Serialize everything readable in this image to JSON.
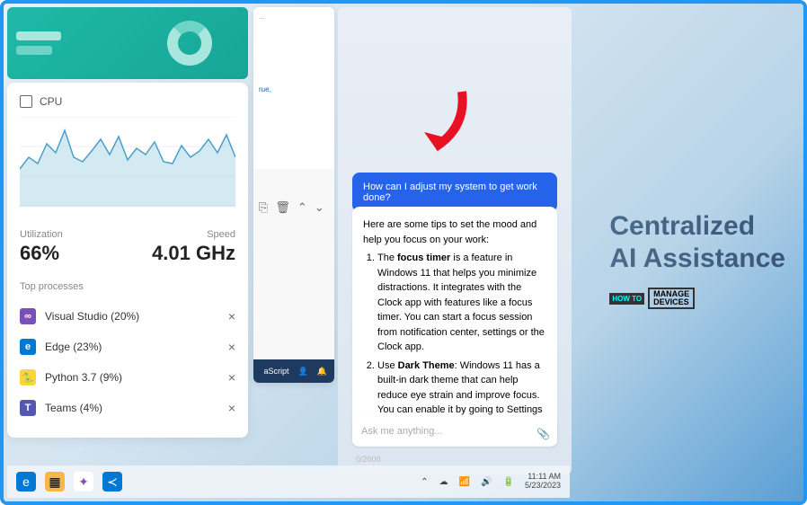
{
  "cpu": {
    "title": "CPU",
    "utilization_label": "Utilization",
    "utilization_value": "66%",
    "speed_label": "Speed",
    "speed_value": "4.01 GHz",
    "top_processes_label": "Top processes",
    "processes": [
      {
        "name": "Visual Studio (20%)",
        "color": "#7b4fb8"
      },
      {
        "name": "Edge (23%)",
        "color": "#0078d4"
      },
      {
        "name": "Python 3.7 (9%)",
        "color": "#ffd43b"
      },
      {
        "name": "Teams (4%)",
        "color": "#5558af"
      }
    ]
  },
  "code_window": {
    "snippet": "rue,",
    "language": "aScript",
    "toolbar_icons": [
      "copy-icon",
      "delete-icon",
      "chevron-up-icon",
      "chevron-down-icon"
    ]
  },
  "ai": {
    "user_message": "How can I adjust my system to get work done?",
    "reply_intro": "Here are some tips to set the mood and help you focus on your work:",
    "tip1_bold": "focus timer",
    "tip1_pre": "The ",
    "tip1_post": " is a feature in Windows 11 that helps you minimize distractions. It integrates with the Clock app with features like a focus timer. You can start a focus session from notification center, settings or the Clock app.",
    "tip2_bold": "Dark Theme",
    "tip2_pre": "Use ",
    "tip2_post": ": Windows 11 has a built-in dark theme that can help reduce eye strain and improve focus. You can enable it by going to Settings >",
    "input_placeholder": "Ask me anything...",
    "char_count": "0/2000"
  },
  "taskbar": {
    "time": "11:11 AM",
    "date": "5/23/2023",
    "tray_icons": [
      "chevron-up-icon",
      "cloud-icon",
      "wifi-icon",
      "volume-icon",
      "battery-icon"
    ],
    "apps": [
      {
        "name": "edge",
        "color": "#0078d4"
      },
      {
        "name": "files",
        "color": "#f7b84b"
      },
      {
        "name": "copilot",
        "color": "#7b4fb8"
      },
      {
        "name": "vscode",
        "color": "#0078d4"
      }
    ]
  },
  "promo": {
    "line1": "Centralized",
    "line2": "AI Assistance",
    "logo_how": "HOW\nTO",
    "logo_manage": "MANAGE",
    "logo_devices": "DEVICES"
  },
  "chart_data": {
    "type": "line",
    "title": "CPU usage",
    "ylim": [
      0,
      100
    ],
    "values": [
      42,
      55,
      48,
      70,
      60,
      85,
      55,
      50,
      62,
      75,
      58,
      78,
      52,
      65,
      58,
      72,
      50,
      48,
      68,
      55,
      62,
      75,
      60,
      80,
      55
    ]
  }
}
